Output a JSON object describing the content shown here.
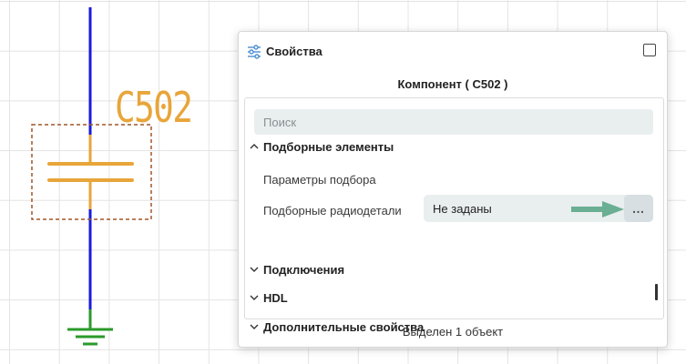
{
  "schematic": {
    "ref_designator": "C502",
    "colors": {
      "wire": "#1a1adc",
      "component": "#e8a53a",
      "selection": "#a0562a",
      "ground": "#2a9a2a"
    },
    "icons": [
      "capacitor-symbol",
      "ground-symbol"
    ]
  },
  "panel": {
    "title": "Свойства",
    "header_icon": "sliders-icon",
    "component_title": "Компонент ( C502 )",
    "search": {
      "placeholder": "Поиск",
      "value": ""
    },
    "sections": [
      {
        "label": "Подборные элементы",
        "expanded": true
      },
      {
        "label": "Подключения",
        "expanded": false
      },
      {
        "label": "HDL",
        "expanded": false
      },
      {
        "label": "Дополнительные свойства",
        "expanded": false
      }
    ],
    "properties": [
      {
        "label": "Параметры подбора",
        "value": ""
      },
      {
        "label": "Подборные радиодетали",
        "value": "Не заданы",
        "action": "…"
      }
    ],
    "status": "Выделен 1 объект"
  }
}
